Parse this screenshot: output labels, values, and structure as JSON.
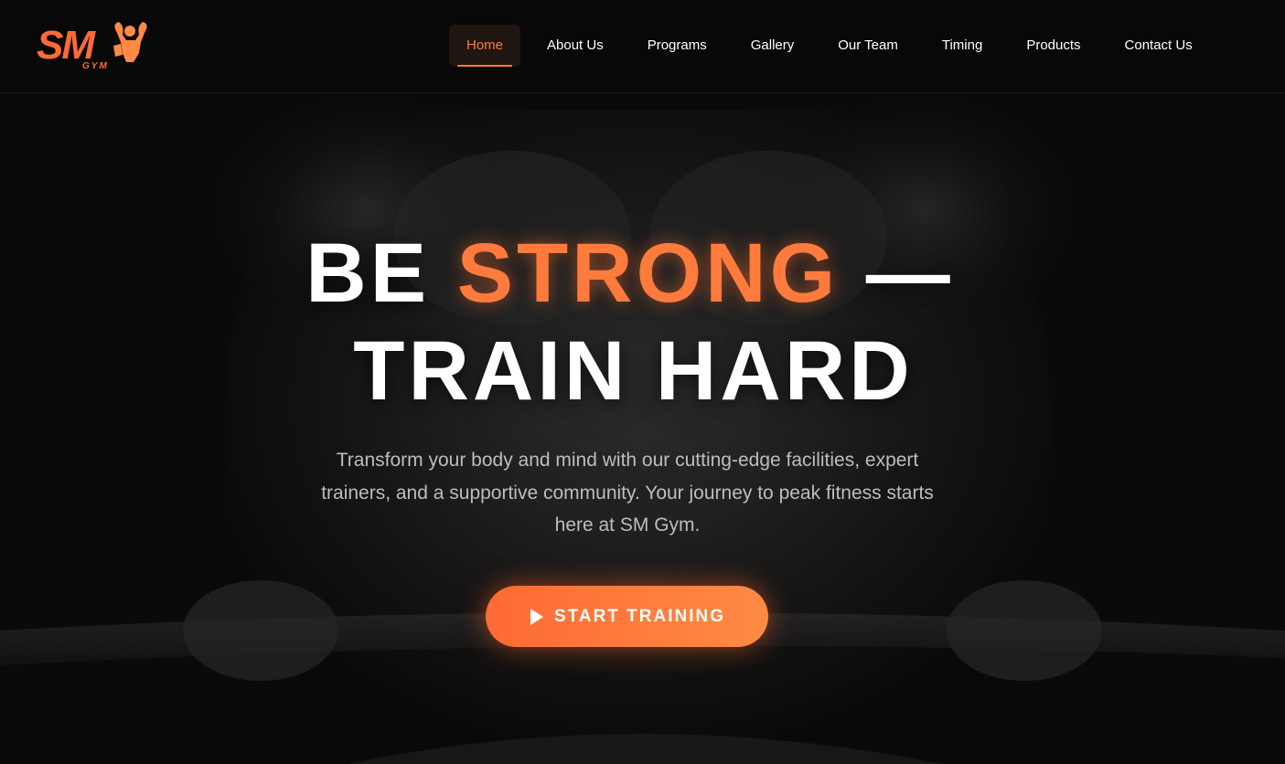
{
  "brand": {
    "logo_text": "SM",
    "logo_subtext": "GYM",
    "logo_icon": "flexing-bodybuilder-icon",
    "accent_color": "#ff7a3d"
  },
  "nav": {
    "items": [
      {
        "label": "Home",
        "active": true
      },
      {
        "label": "About Us",
        "active": false
      },
      {
        "label": "Programs",
        "active": false
      },
      {
        "label": "Gallery",
        "active": false
      },
      {
        "label": "Our Team",
        "active": false
      },
      {
        "label": "Timing",
        "active": false
      },
      {
        "label": "Products",
        "active": false
      },
      {
        "label": "Contact Us",
        "active": false
      }
    ]
  },
  "hero": {
    "headline_part1": "BE ",
    "headline_accent": "STRONG",
    "headline_part2": " —",
    "headline_line2": "TRAIN HARD",
    "subtitle": "Transform your body and mind with our cutting-edge facilities, expert trainers, and a supportive community. Your journey to peak fitness starts here at SM Gym.",
    "cta_label": "START TRAINING",
    "cta_icon": "play-icon"
  }
}
